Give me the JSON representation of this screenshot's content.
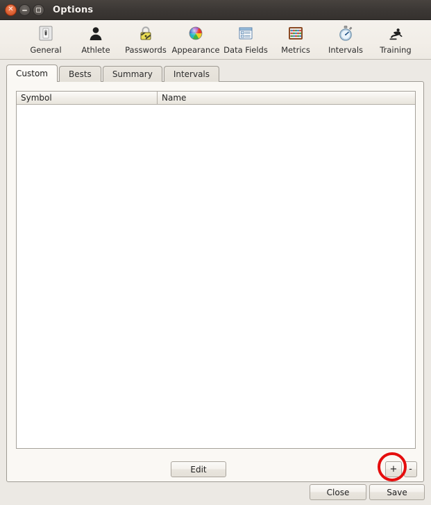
{
  "window": {
    "title": "Options",
    "controls": [
      {
        "name": "close",
        "glyph": "×"
      },
      {
        "name": "minimize",
        "glyph": "–"
      },
      {
        "name": "maximize",
        "glyph": "□"
      }
    ]
  },
  "toolbar": {
    "items": [
      {
        "label": "General",
        "icon": "switch-icon"
      },
      {
        "label": "Athlete",
        "icon": "person-icon"
      },
      {
        "label": "Passwords",
        "icon": "padlock-icon"
      },
      {
        "label": "Appearance",
        "icon": "color-wheel-icon"
      },
      {
        "label": "Data Fields",
        "icon": "form-window-icon"
      },
      {
        "label": "Metrics",
        "icon": "abacus-icon"
      },
      {
        "label": "Intervals",
        "icon": "stopwatch-icon"
      },
      {
        "label": "Training",
        "icon": "exercise-icon"
      }
    ]
  },
  "tabs": [
    {
      "label": "Custom",
      "active": true
    },
    {
      "label": "Bests",
      "active": false
    },
    {
      "label": "Summary",
      "active": false
    },
    {
      "label": "Intervals",
      "active": false
    }
  ],
  "table": {
    "columns": [
      "Symbol",
      "Name"
    ],
    "rows": []
  },
  "panel_buttons": {
    "edit_label": "Edit",
    "add_label": "+",
    "remove_label": "-"
  },
  "dialog_buttons": {
    "close_label": "Close",
    "save_label": "Save"
  },
  "annotation": {
    "target": "add-button",
    "shape": "circle",
    "color": "#e50d0d"
  },
  "colors": {
    "titlebar": "#3c3835",
    "toolbar": "#f2eee8",
    "dialog_bg": "#ece9e4",
    "panel_bg": "#faf8f4",
    "list_bg": "#ffffff",
    "border": "#9e9a93",
    "annotation_red": "#e50d0d"
  }
}
